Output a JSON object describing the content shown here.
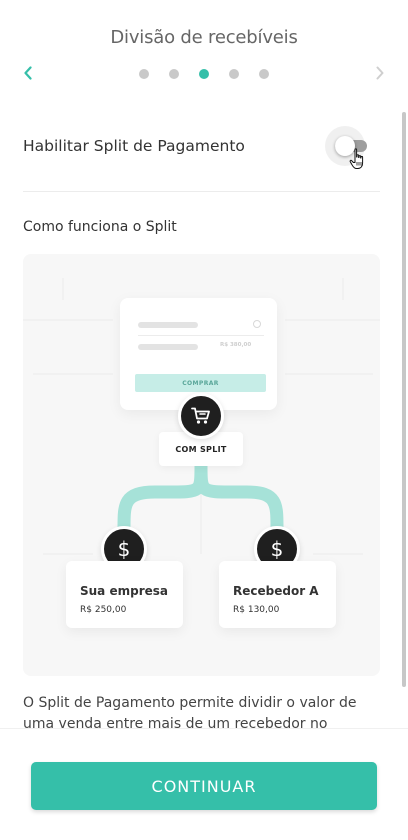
{
  "header": {
    "title": "Divisão de recebíveis",
    "steps_total": 5,
    "active_step": 3
  },
  "toggle_row": {
    "label": "Habilitar Split de Pagamento",
    "enabled": false
  },
  "section": {
    "title": "Como funciona o Split"
  },
  "illustration": {
    "checkout_price": "R$ 380,00",
    "checkout_button": "COMPRAR",
    "split_label": "COM SPLIT",
    "receivers": [
      {
        "name": "Sua empresa",
        "value": "R$ 250,00"
      },
      {
        "name": "Recebedor A",
        "value": "R$ 130,00"
      }
    ]
  },
  "description": "O Split de Pagamento permite dividir o valor de uma venda entre mais de um recebedor no momento da",
  "footer": {
    "cta_label": "CONTINUAR"
  },
  "colors": {
    "accent": "#35bfa9",
    "flow_path": "#a6e2d8",
    "icon_dark": "#1f1f1f"
  },
  "icons": [
    "chevron-left-icon",
    "chevron-right-icon",
    "cart-icon",
    "dollar-icon",
    "hand-cursor-icon"
  ]
}
